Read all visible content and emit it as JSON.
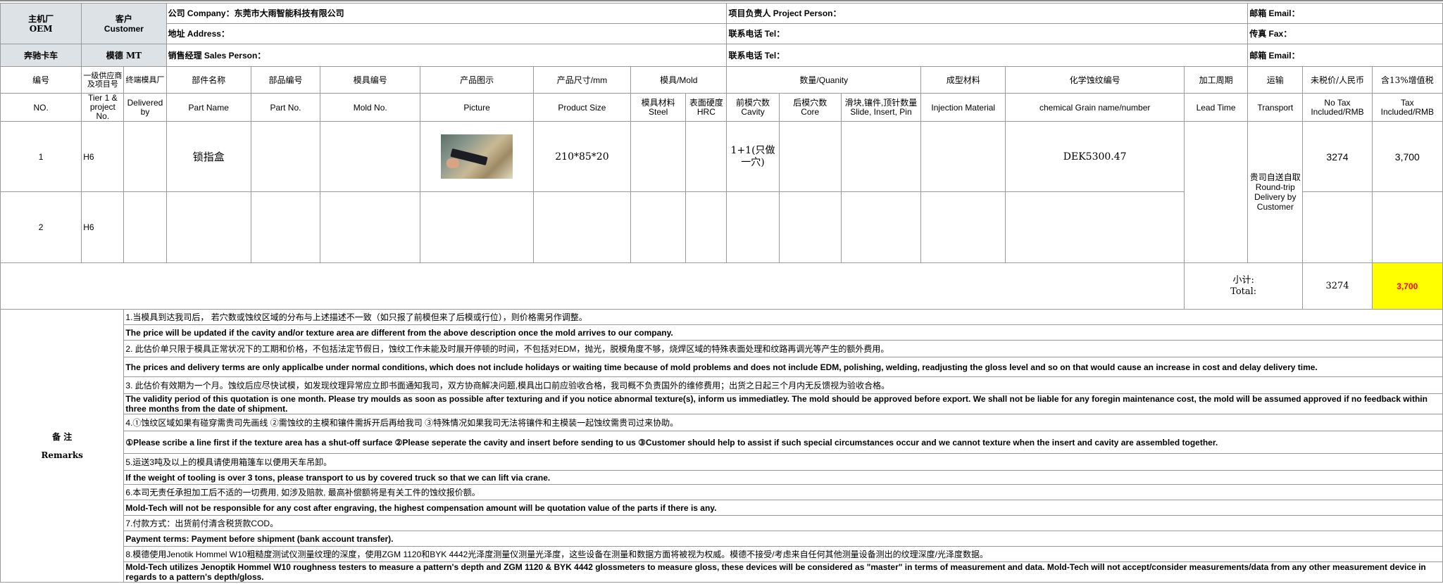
{
  "header": {
    "oem_label": "主机厂\nOEM",
    "oem_value": "奔驰卡车",
    "customer_label": "客户\nCustomer",
    "customer_value": "模德 MT",
    "company": "公司 Company：东莞市大雨智能科技有限公司",
    "address": "地址 Address：",
    "sales": "销售经理 Sales Person：",
    "project_person": "项目负责人 Project Person：",
    "tel1": "联系电话 Tel：",
    "tel2": "联系电话 Tel：",
    "email1": "邮箱 Email：",
    "fax": "传真 Fax：",
    "email2": "邮箱 Email："
  },
  "columns_cn": [
    "编号",
    "一级供应商及项目号",
    "终端模具厂",
    "部件名称",
    "部品编号",
    "模具编号",
    "产品图示",
    "产品尺寸/mm",
    "模具/Mold",
    "数量/Quanity",
    "成型材料",
    "化学蚀纹编号",
    "加工周期",
    "运输",
    "未税价/人民币",
    "含13%增值税"
  ],
  "columns_en": [
    "NO.",
    "Tier 1 & project No.",
    "Delivered by",
    "Part Name",
    "Part No.",
    "Mold No.",
    "Picture",
    "Product Size",
    "模具材料\nSteel",
    "表面硬度\nHRC",
    "前模穴数\nCavity",
    "后模穴数\nCore",
    "滑块,镶件,顶针数量\nSlide, Insert, Pin",
    "Injection Material",
    "chemical Grain name/number",
    "Lead Time",
    "Transport",
    "No Tax Included/RMB",
    "Tax Included/RMB"
  ],
  "rows": [
    {
      "no": "1",
      "tier": "H6",
      "part_name": "锁指盒",
      "size": "210*85*20",
      "cavity": "1+1(只做一穴)",
      "grain": "DEK5300.47",
      "no_tax": "3274",
      "tax": "3,700"
    },
    {
      "no": "2",
      "tier": "H6",
      "part_name": "",
      "size": "",
      "cavity": "",
      "grain": "",
      "no_tax": "",
      "tax": ""
    }
  ],
  "transport": "贵司自送自取\nRound-trip Delivery by Customer",
  "subtotal": {
    "label": "小计:\nTotal:",
    "no_tax": "3274",
    "tax": "3,700"
  },
  "remarks_label": "备  注\nRemarks",
  "remarks": [
    {
      "text": "1.当模具到达我司后， 若穴数或蚀纹区域的分布与上述描述不一致（如只报了前模但来了后模或行位），则价格需另作调整。",
      "bold": false
    },
    {
      "text": "The price will be updated if the cavity and/or texture area are different from the above description once the mold arrives to our company.",
      "bold": true
    },
    {
      "text": "2. 此估价单只限于模具正常状况下的工期和价格，不包括法定节假日，蚀纹工作未能及时展开停顿的时间，不包括对EDM，抛光，脱模角度不够，烧焊区域的特殊表面处理和纹路再调光等产生的额外费用。",
      "bold": false
    },
    {
      "text": "The prices and delivery terms are only applicalbe under normal conditions, which does not include holidays or waiting time because of mold problems and does not include EDM,  polishing, welding, readjusting the gloss level and so on that would cause an increase in cost and delay delivery time.",
      "bold": true
    },
    {
      "text": "3. 此估价有效期为一个月。蚀纹后应尽快试模，如发现纹理异常应立即书面通知我司，双方协商解决问题,模具出口前应验收合格，我司概不负责国外的维修费用；出货之日起三个月内无反馈视为验收合格。",
      "bold": false
    },
    {
      "text": "The validity period of this quotation is one month. Please try moulds as soon as possible after texturing and if you notice abnormal texture(s), inform us immediatley. The mold should be approved before export. We shall not be liable for any foregin maintenance cost, the mold will be assumed approved if no feedback within three months from the date of shipment.",
      "bold": true
    },
    {
      "text": "4.①蚀纹区域如果有碰穿需贵司先画线 ②需蚀纹的主模和镶件需拆开后再给我司 ③特殊情况如果我司无法将镶件和主模装一起蚀纹需贵司过来协助。",
      "bold": false
    },
    {
      "text": "①Please scribe a line first if the texture area has a shut-off surface ②Please seperate the cavity and insert before sending to us ③Customer should help to assist if such special circumstances occur and we cannot texture when the insert and cavity are assembled together.",
      "bold": true
    },
    {
      "text": "5.运送3吨及以上的模具请使用箱篷车以便用天车吊卸。",
      "bold": false
    },
    {
      "text": "If the weight of tooling is over 3 tons, please transport to us by covered truck so that we can lift via crane.",
      "bold": true
    },
    {
      "text": "6.本司无责任承担加工后不适的一切费用, 如涉及赔款, 最高补偿额将是有关工件的蚀纹报价额。",
      "bold": false
    },
    {
      "text": "Mold-Tech will not be responsible for any cost after engraving,  the highest compensation amount will be quotation value of the parts if there is any.",
      "bold": true
    },
    {
      "text": "7.付款方式：出货前付清含税货款COD。",
      "bold": false
    },
    {
      "text": "Payment terms: Payment before shipment (bank account transfer).",
      "bold": true
    },
    {
      "text": "8.模德使用Jenotik Hommel W10粗糙度测试仪测量纹理的深度，使用ZGM 1120和BYK 4442光泽度测量仪测量光泽度，这些设备在测量和数据方面将被视为权威。模德不接受/考虑来自任何其他测量设备测出的纹理深度/光泽度数据。",
      "bold": false
    },
    {
      "text": "Mold-Tech utilizes Jenoptik Hommel W10 roughness testers to measure a pattern's depth and ZGM 1120 & BYK 4442 glossmeters to measure gloss, these devices will be considered as \"master\" in terms of measurement and data. Mold-Tech will not accept/consider measurements/data from any other measurement device in regards to a pattern's depth/gloss.",
      "bold": true
    }
  ]
}
